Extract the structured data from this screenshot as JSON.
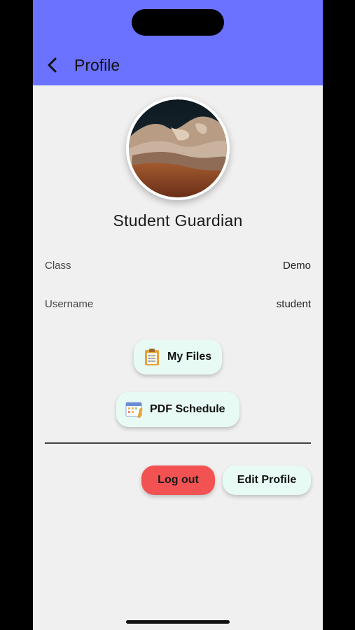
{
  "appbar": {
    "title": "Profile",
    "color": "#6a72ff",
    "back_icon": "chevron-left-icon"
  },
  "profile": {
    "name": "Student Guardian",
    "avatar_icon": "desert-rock-photo"
  },
  "info": {
    "class_label": "Class",
    "class_value": "Demo",
    "username_label": "Username",
    "username_value": "student"
  },
  "actions": {
    "my_files_label": "My Files",
    "my_files_icon": "clipboard-icon",
    "pdf_schedule_label": "PDF Schedule",
    "pdf_schedule_icon": "calendar-pencil-icon",
    "logout_label": "Log out",
    "logout_color": "#f25252",
    "edit_profile_label": "Edit Profile"
  }
}
